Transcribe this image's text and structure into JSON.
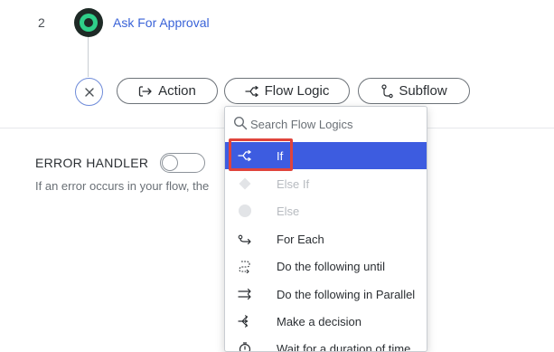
{
  "step": {
    "number": "2",
    "title": "Ask For Approval"
  },
  "buttons": {
    "action": "Action",
    "flow_logic": "Flow Logic",
    "subflow": "Subflow"
  },
  "error_handler": {
    "label": "ERROR HANDLER",
    "description": "If an error occurs in your flow, the"
  },
  "flow_logic_menu": {
    "search_placeholder": "Search Flow Logics",
    "items": [
      {
        "label": "If",
        "icon": "branch-icon",
        "state": "selected"
      },
      {
        "label": "Else If",
        "icon": "diamond-icon",
        "state": "disabled"
      },
      {
        "label": "Else",
        "icon": "circle-icon",
        "state": "disabled"
      },
      {
        "label": "For Each",
        "icon": "loop-arrow-icon",
        "state": "enabled"
      },
      {
        "label": "Do the following until",
        "icon": "repeat-until-icon",
        "state": "enabled"
      },
      {
        "label": "Do the following in Parallel",
        "icon": "parallel-arrows-icon",
        "state": "enabled"
      },
      {
        "label": "Make a decision",
        "icon": "decision-icon",
        "state": "enabled"
      },
      {
        "label": "Wait for a duration of time",
        "icon": "timer-icon",
        "state": "enabled"
      }
    ]
  },
  "colors": {
    "accent": "#3d5ce0",
    "link": "#3a63d8",
    "highlight": "#e0443c",
    "approval_node": "#2fd08a"
  }
}
